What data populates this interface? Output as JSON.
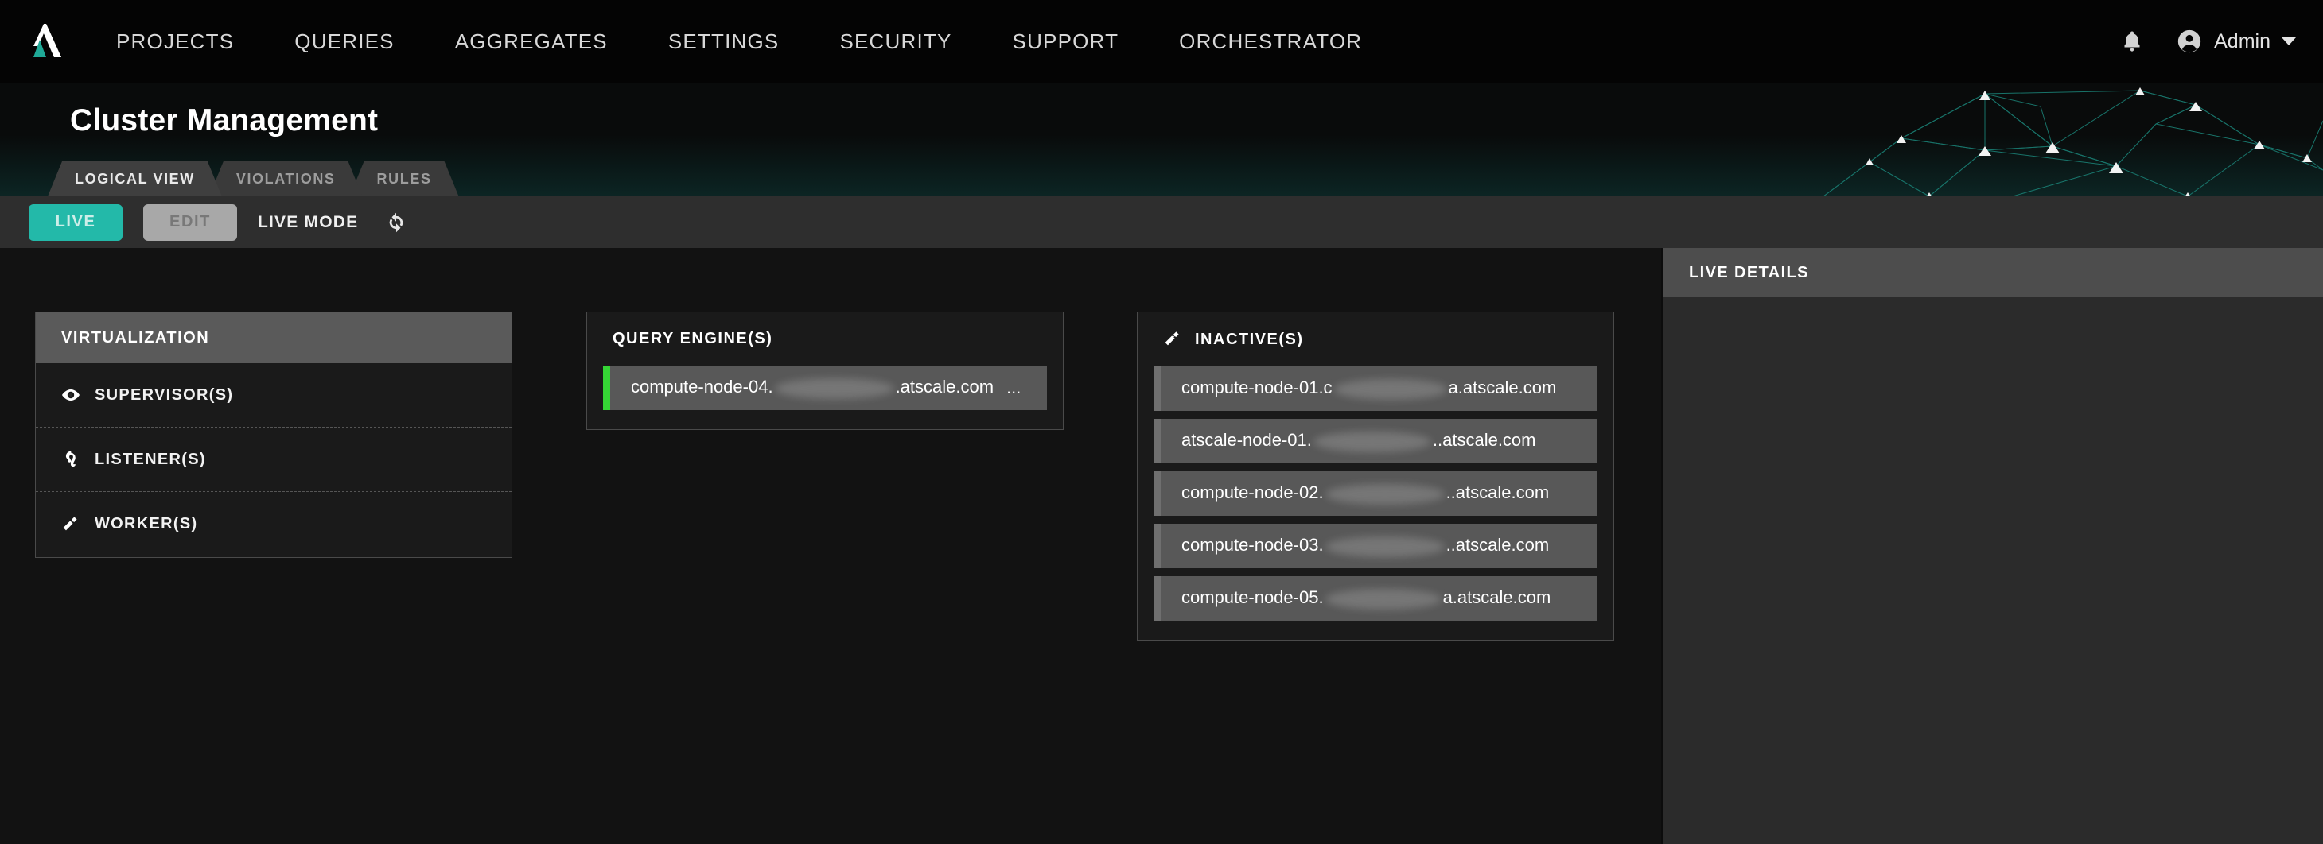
{
  "brand": {
    "logo_icon": "atscale-triangle-logo",
    "accent_teal": "#23b9a9"
  },
  "topnav": {
    "items": [
      {
        "label": "PROJECTS"
      },
      {
        "label": "QUERIES"
      },
      {
        "label": "AGGREGATES"
      },
      {
        "label": "SETTINGS"
      },
      {
        "label": "SECURITY"
      },
      {
        "label": "SUPPORT"
      },
      {
        "label": "ORCHESTRATOR"
      }
    ],
    "notifications_icon": "bell-icon",
    "account_icon": "user-avatar-icon",
    "account_label": "Admin",
    "account_caret_icon": "chevron-down-icon"
  },
  "banner": {
    "title": "Cluster Management",
    "decoration_icon": "network-constellation-graphic",
    "tabs": [
      {
        "label": "LOGICAL VIEW",
        "active": true
      },
      {
        "label": "VIOLATIONS",
        "active": false
      },
      {
        "label": "RULES",
        "active": false
      }
    ]
  },
  "toolbar": {
    "live_label": "LIVE",
    "edit_label": "EDIT",
    "mode_label": "LIVE MODE",
    "refresh_icon": "refresh-sync-icon"
  },
  "virtualization": {
    "title": "VIRTUALIZATION",
    "rows": [
      {
        "label": "SUPERVISOR(S)",
        "icon": "eye-icon"
      },
      {
        "label": "LISTENER(S)",
        "icon": "ear-icon"
      },
      {
        "label": "WORKER(S)",
        "icon": "hammer-icon"
      }
    ]
  },
  "query_engines": {
    "title": "QUERY ENGINE(S)",
    "nodes": [
      {
        "prefix": "compute-node-04.",
        "redacted_width": 150,
        "suffix": ".atscale.com",
        "trailing": "...",
        "status": "green",
        "status_color": "#35d635"
      }
    ]
  },
  "inactive": {
    "title": "INACTIVE(S)",
    "icon": "hammer-icon",
    "nodes": [
      {
        "prefix": "compute-node-01.c",
        "redacted_width": 142,
        "suffix": "a.atscale.com",
        "status": "gray"
      },
      {
        "prefix": "atscale-node-01.",
        "redacted_width": 148,
        "suffix": "..atscale.com",
        "status": "gray"
      },
      {
        "prefix": "compute-node-02.",
        "redacted_width": 150,
        "suffix": "..atscale.com",
        "status": "gray"
      },
      {
        "prefix": "compute-node-03.",
        "redacted_width": 150,
        "suffix": "..atscale.com",
        "status": "gray"
      },
      {
        "prefix": "compute-node-05.",
        "redacted_width": 146,
        "suffix": "a.atscale.com",
        "status": "gray"
      }
    ]
  },
  "live_details": {
    "title": "LIVE DETAILS",
    "body_text": ""
  }
}
